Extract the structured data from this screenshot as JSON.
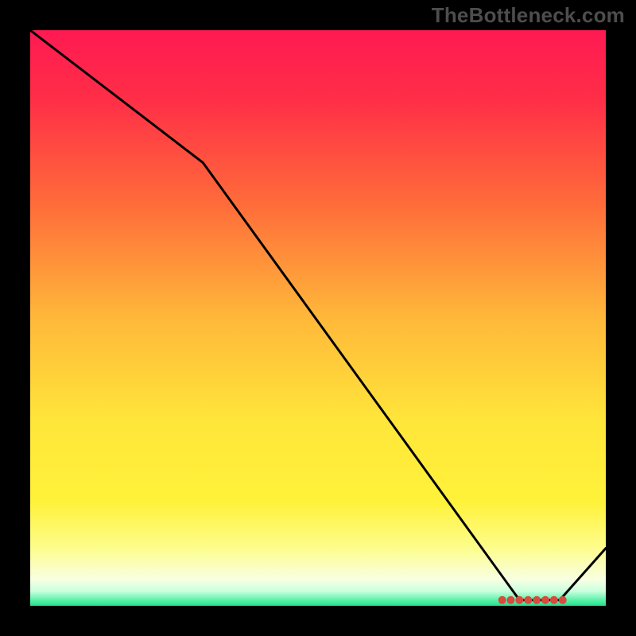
{
  "watermark": "TheBottleneck.com",
  "colors": {
    "bg": "#000000",
    "watermark": "#4d4d4d",
    "line": "#000000",
    "marker": "#d94a3f",
    "gradient_stops": [
      {
        "offset": 0.0,
        "color": "#ff1a52"
      },
      {
        "offset": 0.12,
        "color": "#ff2e47"
      },
      {
        "offset": 0.3,
        "color": "#ff6b3a"
      },
      {
        "offset": 0.5,
        "color": "#ffb83a"
      },
      {
        "offset": 0.68,
        "color": "#ffe63a"
      },
      {
        "offset": 0.82,
        "color": "#fff23a"
      },
      {
        "offset": 0.9,
        "color": "#fdfd8d"
      },
      {
        "offset": 0.955,
        "color": "#f8ffe3"
      },
      {
        "offset": 0.975,
        "color": "#c7ffde"
      },
      {
        "offset": 0.99,
        "color": "#5af2a8"
      },
      {
        "offset": 1.0,
        "color": "#22e08f"
      }
    ]
  },
  "chart_data": {
    "type": "line",
    "title": "",
    "xlabel": "",
    "ylabel": "",
    "xlim": [
      0,
      100
    ],
    "ylim": [
      0,
      100
    ],
    "series": [
      {
        "name": "curve",
        "x": [
          0,
          30,
          85,
          88,
          92,
          100
        ],
        "y": [
          100,
          77,
          1,
          1,
          1,
          10
        ]
      }
    ],
    "markers": {
      "name": "highlight-band",
      "x": [
        82,
        83.5,
        85,
        86.5,
        88,
        89.5,
        91,
        92.5
      ],
      "y": [
        1.0,
        1.0,
        1.0,
        1.0,
        1.0,
        1.0,
        1.0,
        1.0
      ]
    }
  }
}
